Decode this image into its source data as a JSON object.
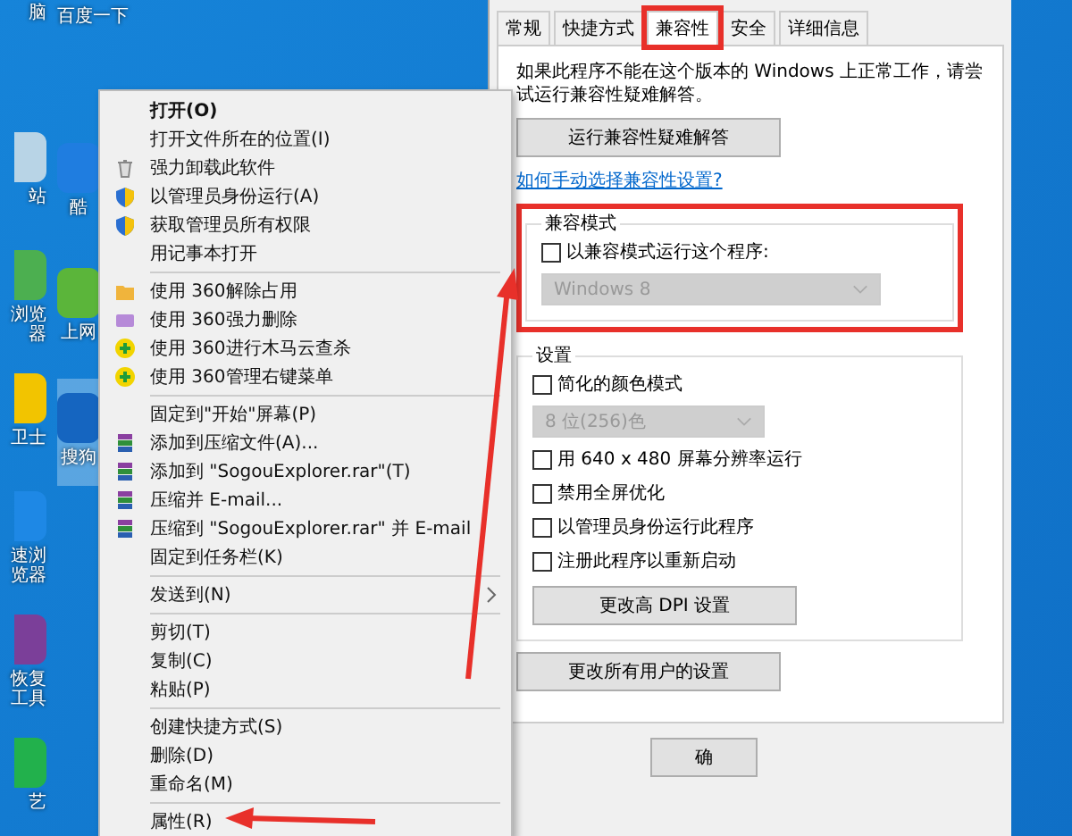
{
  "desktop": {
    "columns": [
      [
        {
          "label": "脑"
        },
        {
          "label": "站",
          "color": "#b8d4e6"
        },
        {
          "label": "浏览器",
          "color": "#4caf50"
        },
        {
          "label": "卫士",
          "color": "#f2c400"
        },
        {
          "label": "速浏览器",
          "color": "#1e88e5"
        },
        {
          "label": "恢复工具",
          "color": "#7b3f99"
        },
        {
          "label": "艺",
          "color": "#22b14c"
        }
      ],
      [
        {
          "label": "百度一下"
        },
        {
          "label": "酷",
          "color": "#1f7de0"
        },
        {
          "label": "上网",
          "color": "#5bb53a"
        },
        {
          "label": "搜狗",
          "color": "#1565c0",
          "selected": true
        }
      ]
    ]
  },
  "context_menu": {
    "items": [
      {
        "kind": "plain",
        "label": "打开(O)",
        "bold": true
      },
      {
        "kind": "plain",
        "label": "打开文件所在的位置(I)",
        "bold": false
      },
      {
        "kind": "trash",
        "label": "强力卸载此软件"
      },
      {
        "kind": "shield",
        "label": "以管理员身份运行(A)"
      },
      {
        "kind": "shield",
        "label": "获取管理员所有权限"
      },
      {
        "kind": "plain",
        "label": "用记事本打开"
      },
      {
        "kind": "separator"
      },
      {
        "kind": "folder",
        "label": "使用 360解除占用"
      },
      {
        "kind": "shredder",
        "label": "使用 360强力删除"
      },
      {
        "kind": "plus",
        "label": "使用 360进行木马云查杀"
      },
      {
        "kind": "plus",
        "label": "使用 360管理右键菜单"
      },
      {
        "kind": "separator"
      },
      {
        "kind": "plain",
        "label": "固定到\"开始\"屏幕(P)"
      },
      {
        "kind": "archive",
        "label": "添加到压缩文件(A)..."
      },
      {
        "kind": "archive",
        "label": "添加到 \"SogouExplorer.rar\"(T)"
      },
      {
        "kind": "archive",
        "label": "压缩并 E-mail..."
      },
      {
        "kind": "archive",
        "label": "压缩到 \"SogouExplorer.rar\" 并 E-mail"
      },
      {
        "kind": "plain",
        "label": "固定到任务栏(K)"
      },
      {
        "kind": "separator"
      },
      {
        "kind": "plain",
        "label": "发送到(N)",
        "submenu": true
      },
      {
        "kind": "separator"
      },
      {
        "kind": "plain",
        "label": "剪切(T)"
      },
      {
        "kind": "plain",
        "label": "复制(C)"
      },
      {
        "kind": "plain",
        "label": "粘贴(P)"
      },
      {
        "kind": "separator"
      },
      {
        "kind": "plain",
        "label": "创建快捷方式(S)"
      },
      {
        "kind": "plain",
        "label": "删除(D)"
      },
      {
        "kind": "plain",
        "label": "重命名(M)"
      },
      {
        "kind": "separator"
      },
      {
        "kind": "plain",
        "label": "属性(R)"
      }
    ]
  },
  "dialog": {
    "tabs": [
      {
        "label": "常规",
        "selected": false
      },
      {
        "label": "快捷方式",
        "selected": false
      },
      {
        "label": "兼容性",
        "selected": true
      },
      {
        "label": "安全",
        "selected": false
      },
      {
        "label": "详细信息",
        "selected": false
      }
    ],
    "description": "如果此程序不能在这个版本的 Windows 上正常工作，请尝试运行兼容性疑难解答。",
    "troubleshoot_button": "运行兼容性疑难解答",
    "help_link": "如何手动选择兼容性设置?",
    "compat_mode": {
      "title": "兼容模式",
      "checkbox": {
        "label": "以兼容模式运行这个程序:",
        "checked": false
      },
      "select": {
        "value": "Windows 8",
        "disabled": true
      }
    },
    "settings": {
      "title": "设置",
      "items": [
        {
          "kind": "checkbox",
          "label": "简化的颜色模式",
          "checked": false
        },
        {
          "kind": "select",
          "value": "8 位(256)色",
          "disabled": true
        },
        {
          "kind": "checkbox",
          "label": "用 640 x 480 屏幕分辨率运行",
          "checked": false
        },
        {
          "kind": "checkbox",
          "label": "禁用全屏优化",
          "checked": false
        },
        {
          "kind": "checkbox",
          "label": "以管理员身份运行此程序",
          "checked": false
        },
        {
          "kind": "checkbox",
          "label": "注册此程序以重新启动",
          "checked": false
        }
      ],
      "dpi_button": "更改高 DPI 设置"
    },
    "all_users_button": "更改所有用户的设置",
    "footer_buttons": [
      "确"
    ]
  }
}
